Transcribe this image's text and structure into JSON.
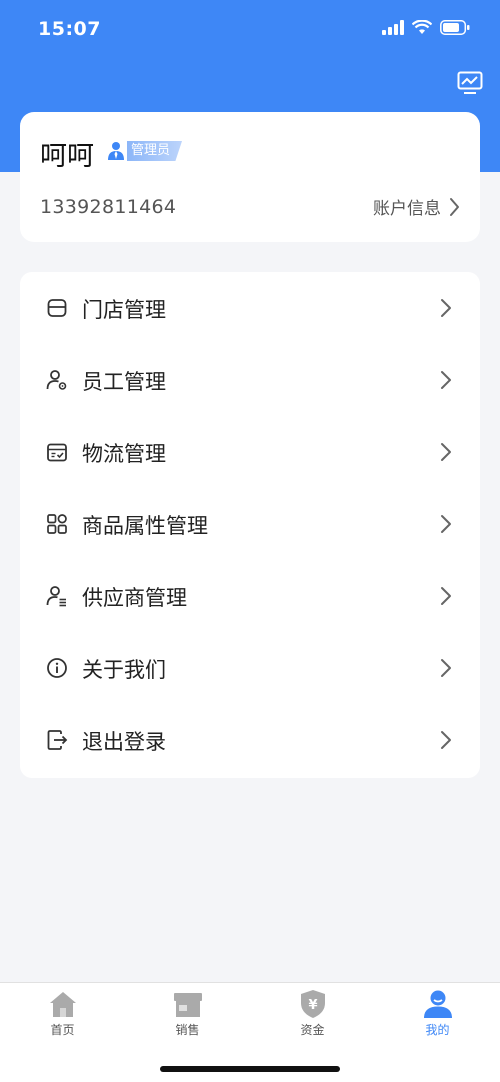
{
  "status_bar": {
    "time": "15:07"
  },
  "profile": {
    "name": "呵呵",
    "role": "管理员",
    "phone": "13392811464",
    "account_info_label": "账户信息"
  },
  "menu": [
    {
      "label": "门店管理",
      "icon": "store-icon"
    },
    {
      "label": "员工管理",
      "icon": "staff-settings-icon"
    },
    {
      "label": "物流管理",
      "icon": "logistics-box-icon"
    },
    {
      "label": "商品属性管理",
      "icon": "grid-apps-icon"
    },
    {
      "label": "供应商管理",
      "icon": "supplier-user-icon"
    },
    {
      "label": "关于我们",
      "icon": "info-icon"
    },
    {
      "label": "退出登录",
      "icon": "logout-icon"
    }
  ],
  "tabs": [
    {
      "label": "首页",
      "icon": "home-icon",
      "active": false
    },
    {
      "label": "销售",
      "icon": "sales-store-icon",
      "active": false
    },
    {
      "label": "资金",
      "icon": "yuan-shield-icon",
      "active": false
    },
    {
      "label": "我的",
      "icon": "profile-icon",
      "active": true
    }
  ],
  "colors": {
    "primary": "#3e87f6",
    "background": "#f4f5f8",
    "inactive_tab": "#aaaaaa"
  }
}
